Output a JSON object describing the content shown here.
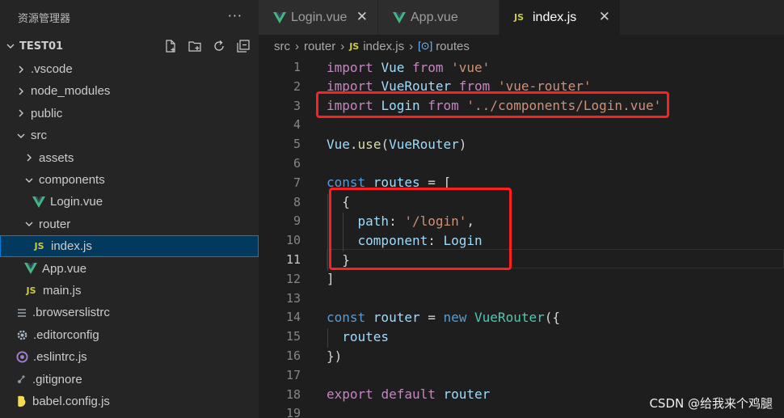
{
  "explorer": {
    "title": "资源管理器",
    "more": "···",
    "project": "TEST01",
    "actions": [
      "new-file-icon",
      "new-folder-icon",
      "refresh-icon",
      "collapse-all-icon"
    ],
    "items": [
      {
        "label": ".vscode",
        "type": "folder",
        "open": false,
        "depth": 1
      },
      {
        "label": "node_modules",
        "type": "folder",
        "open": false,
        "depth": 1
      },
      {
        "label": "public",
        "type": "folder",
        "open": false,
        "depth": 1
      },
      {
        "label": "src",
        "type": "folder",
        "open": true,
        "depth": 1
      },
      {
        "label": "assets",
        "type": "folder",
        "open": false,
        "depth": 2
      },
      {
        "label": "components",
        "type": "folder",
        "open": true,
        "depth": 2
      },
      {
        "label": "Login.vue",
        "type": "vue",
        "depth": 3
      },
      {
        "label": "router",
        "type": "folder",
        "open": true,
        "depth": 2
      },
      {
        "label": "index.js",
        "type": "js",
        "depth": 3,
        "selected": true
      },
      {
        "label": "App.vue",
        "type": "vue",
        "depth": 2
      },
      {
        "label": "main.js",
        "type": "js",
        "depth": 2
      },
      {
        "label": ".browserslistrc",
        "type": "list",
        "depth": 1
      },
      {
        "label": ".editorconfig",
        "type": "gear",
        "depth": 1
      },
      {
        "label": ".eslintrc.js",
        "type": "eslint",
        "depth": 1
      },
      {
        "label": ".gitignore",
        "type": "git",
        "depth": 1
      },
      {
        "label": "babel.config.js",
        "type": "babel",
        "depth": 1
      }
    ]
  },
  "tabs": [
    {
      "label": "Login.vue",
      "icon": "vue-icon",
      "active": false,
      "close": "✕"
    },
    {
      "label": "App.vue",
      "icon": "vue-icon",
      "active": false
    },
    {
      "label": "index.js",
      "icon": "JS",
      "active": true,
      "close": "✕"
    }
  ],
  "breadcrumb": {
    "parts": [
      "src",
      "router",
      "index.js",
      "routes"
    ],
    "file_icon": "JS",
    "symbol_icon": "[⊙]"
  },
  "code": {
    "current_line": 11,
    "lines": [
      {
        "n": "1",
        "tokens": [
          [
            "kw",
            "import "
          ],
          [
            "id",
            "Vue "
          ],
          [
            "kw",
            "from "
          ],
          [
            "str",
            "'vue'"
          ]
        ]
      },
      {
        "n": "2",
        "tokens": [
          [
            "kw",
            "import "
          ],
          [
            "id",
            "VueRouter "
          ],
          [
            "kw",
            "from "
          ],
          [
            "str",
            "'vue-router'"
          ]
        ]
      },
      {
        "n": "3",
        "tokens": [
          [
            "kw",
            "import "
          ],
          [
            "id",
            "Login "
          ],
          [
            "kw",
            "from "
          ],
          [
            "str",
            "'../components/Login.vue'"
          ]
        ]
      },
      {
        "n": "4",
        "tokens": []
      },
      {
        "n": "5",
        "tokens": [
          [
            "id",
            "Vue"
          ],
          [
            "plain",
            "."
          ],
          [
            "fn",
            "use"
          ],
          [
            "plain",
            "("
          ],
          [
            "id",
            "VueRouter"
          ],
          [
            "plain",
            ")"
          ]
        ]
      },
      {
        "n": "6",
        "tokens": []
      },
      {
        "n": "7",
        "tokens": [
          [
            "kwb",
            "const "
          ],
          [
            "id",
            "routes "
          ],
          [
            "plain",
            "= ["
          ]
        ]
      },
      {
        "n": "8",
        "tokens": [
          [
            "plain",
            "  {"
          ]
        ]
      },
      {
        "n": "9",
        "tokens": [
          [
            "plain",
            "    "
          ],
          [
            "id",
            "path"
          ],
          [
            "plain",
            ": "
          ],
          [
            "str",
            "'/login'"
          ],
          [
            "plain",
            ","
          ]
        ]
      },
      {
        "n": "10",
        "tokens": [
          [
            "plain",
            "    "
          ],
          [
            "id",
            "component"
          ],
          [
            "plain",
            ": "
          ],
          [
            "id",
            "Login"
          ]
        ]
      },
      {
        "n": "11",
        "tokens": [
          [
            "plain",
            "  }"
          ]
        ]
      },
      {
        "n": "12",
        "tokens": [
          [
            "plain",
            "]"
          ]
        ]
      },
      {
        "n": "13",
        "tokens": []
      },
      {
        "n": "14",
        "tokens": [
          [
            "kwb",
            "const "
          ],
          [
            "id",
            "router "
          ],
          [
            "plain",
            "= "
          ],
          [
            "kwb",
            "new "
          ],
          [
            "cls",
            "VueRouter"
          ],
          [
            "plain",
            "({"
          ]
        ]
      },
      {
        "n": "15",
        "tokens": [
          [
            "plain",
            "  "
          ],
          [
            "id",
            "routes"
          ]
        ]
      },
      {
        "n": "16",
        "tokens": [
          [
            "plain",
            "})"
          ]
        ]
      },
      {
        "n": "17",
        "tokens": []
      },
      {
        "n": "18",
        "tokens": [
          [
            "kw",
            "export "
          ],
          [
            "kw",
            "default "
          ],
          [
            "id",
            "router"
          ]
        ]
      },
      {
        "n": "19",
        "tokens": []
      }
    ]
  },
  "watermark": "CSDN @给我来个鸡腿",
  "colors": {
    "highlight": "#ff1f1f",
    "selected": "#04395e",
    "vue": "#41b883",
    "js": "#cbcb41"
  }
}
